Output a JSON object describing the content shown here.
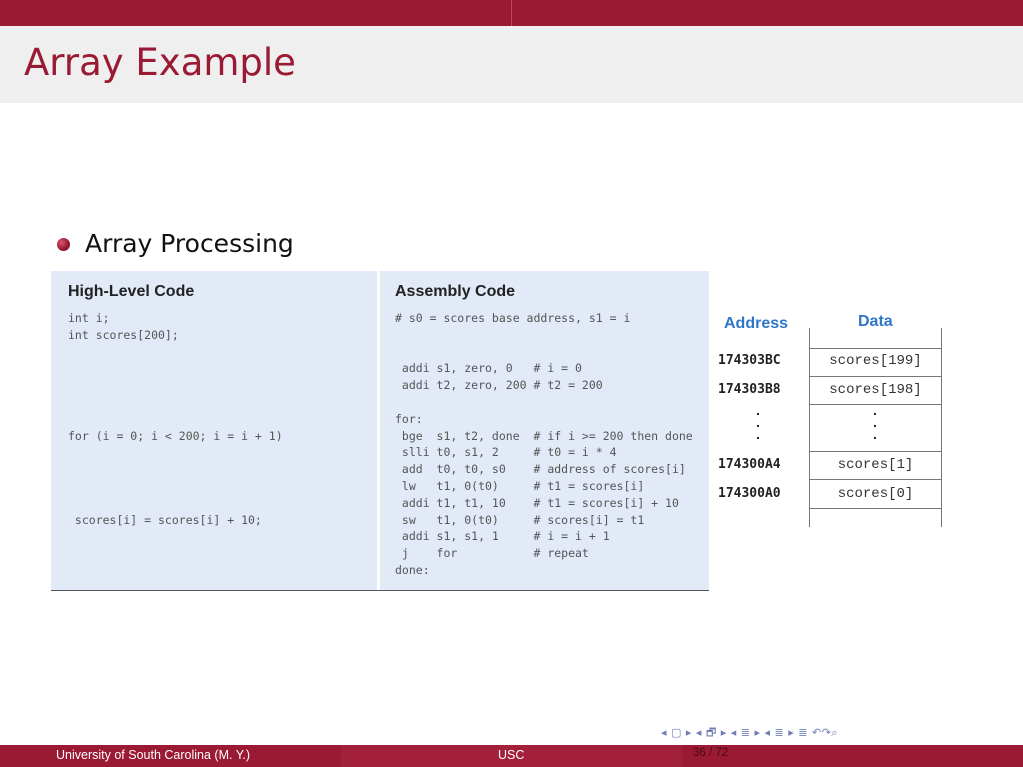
{
  "slide": {
    "title": "Array Example",
    "bullet": "Array Processing"
  },
  "code_table": {
    "high_level_header": "High-Level Code",
    "assembly_header": "Assembly Code",
    "high_level_lines": [
      "int i;",
      "int scores[200];",
      "",
      "",
      "",
      "",
      "",
      "for (i = 0; i < 200; i = i + 1)",
      "",
      "",
      "",
      "",
      " scores[i] = scores[i] + 10;"
    ],
    "assembly_lines": [
      "# s0 = scores base address, s1 = i",
      "",
      "",
      " addi s1, zero, 0   # i = 0",
      " addi t2, zero, 200 # t2 = 200",
      "",
      "for:",
      " bge  s1, t2, done  # if i >= 200 then done",
      " slli t0, s1, 2     # t0 = i * 4",
      " add  t0, t0, s0    # address of scores[i]",
      " lw   t1, 0(t0)     # t1 = scores[i]",
      " addi t1, t1, 10    # t1 = scores[i] + 10",
      " sw   t1, 0(t0)     # scores[i] = t1",
      " addi s1, s1, 1     # i = i + 1",
      " j    for           # repeat",
      "done:"
    ]
  },
  "memory": {
    "address_header": "Address",
    "data_header": "Data",
    "rows": [
      {
        "address": "174303BC",
        "data": "scores[199]"
      },
      {
        "address": "174303B8",
        "data": "scores[198]"
      },
      {
        "address": "174300A4",
        "data": "scores[1]"
      },
      {
        "address": "174300A0",
        "data": "scores[0]"
      }
    ],
    "ellipsis": ".\n.\n."
  },
  "navigation": {
    "symbols": "◂ ▢ ▸  ◂ 🗗 ▸  ◂ ≣ ▸  ◂ ≣ ▸   ≣   ↶↷⌕"
  },
  "footer": {
    "left": "University of South Carolina  (M. Y.)",
    "center": "USC",
    "page": "36 / 72"
  },
  "colors": {
    "brand": "#9b1a33",
    "code_bg": "#e2e9f7",
    "header_blue": "#2e76c8"
  }
}
